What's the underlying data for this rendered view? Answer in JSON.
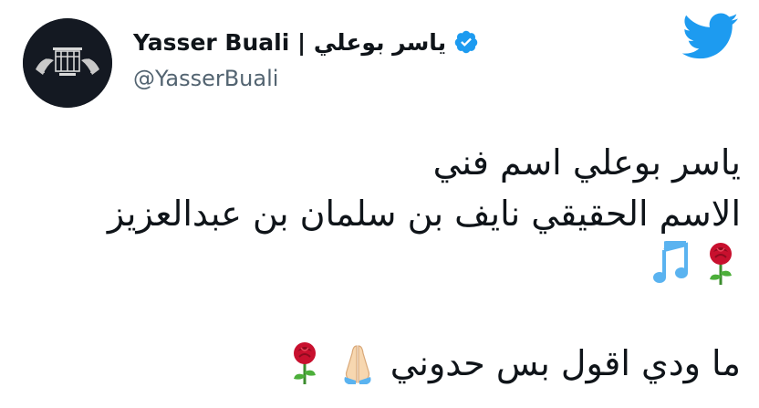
{
  "user": {
    "display_name": "Yasser Buali | ياسر بوعلي",
    "handle": "@YasserBuali",
    "avatar_icon": "avatar-image",
    "verified_icon": "verified-badge-icon"
  },
  "brand": {
    "logo_icon": "twitter-bird-icon",
    "accent_color": "#1d9bf0"
  },
  "tweet": {
    "line_1": "ياسر بوعلي اسم فني",
    "line_2": "الاسم الحقيقي نايف بن سلمان بن عبدالعزيز",
    "line_3_emojis": [
      "rose-icon",
      "musical-notes-icon"
    ],
    "line_4_text": "ما ودي اقول بس حدوني",
    "line_4_emojis": [
      "folded-hands-icon",
      "rose-icon"
    ]
  },
  "colors": {
    "text": "#0f1419",
    "secondary_text": "#536471",
    "rose_red": "#c8102e",
    "notes_blue": "#5ab3f0"
  }
}
